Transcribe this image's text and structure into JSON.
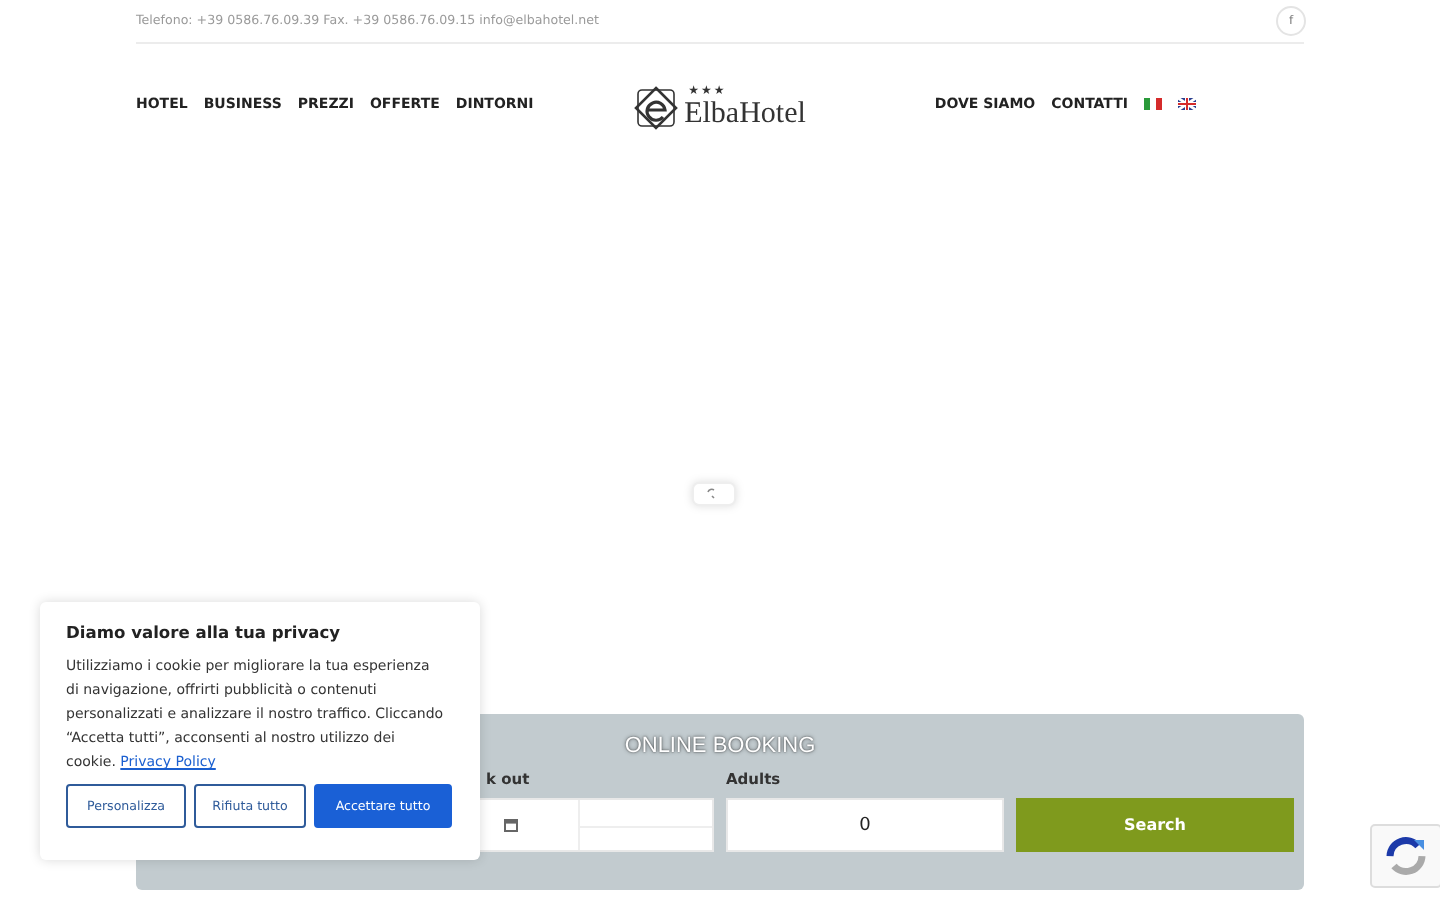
{
  "top_bar": {
    "contact": "Telefono: +39 0586.76.09.39 Fax. +39 0586.76.09.15 info@elbahotel.net",
    "social": "f"
  },
  "header": {
    "nav_left": [
      {
        "label": "HOTEL"
      },
      {
        "label": "BUSINESS"
      },
      {
        "label": "PREZZI"
      },
      {
        "label": "OFFERTE"
      },
      {
        "label": "DINTORNI"
      }
    ],
    "logo": {
      "stars": "★★★",
      "name": "ElbaHotel"
    },
    "nav_right": [
      {
        "label": "DOVE SIAMO"
      },
      {
        "label": "CONTATTI"
      }
    ],
    "languages": [
      {
        "kind": "it"
      },
      {
        "kind": "en"
      }
    ]
  },
  "booking": {
    "title": "ONLINE BOOKING",
    "checkout_label": "k out",
    "adults_label": "Adults",
    "adults_value": "0",
    "search_button": "Search"
  },
  "cookie_banner": {
    "title": "Diamo valore alla tua privacy",
    "text": "Utilizziamo i cookie per migliorare la tua esperienza di navigazione, offrirti pubblicità o contenuti personalizzati e analizzare il nostro traffico. Cliccando “Accetta tutti”, acconsenti al nostro utilizzo dei cookie.",
    "link": "Privacy Policy",
    "buttons": [
      {
        "label": "Personalizza",
        "kind": "outline"
      },
      {
        "label": "Rifiuta tutto",
        "kind": "outline"
      },
      {
        "label": "Accettare tutto",
        "kind": "primary"
      }
    ]
  }
}
